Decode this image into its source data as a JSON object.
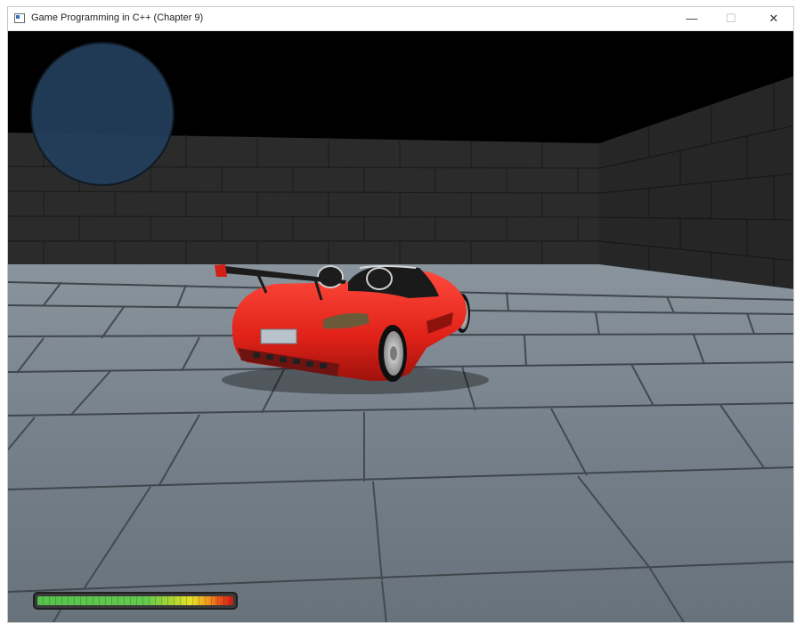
{
  "window": {
    "title": "Game Programming in C++ (Chapter 9)",
    "controls": {
      "minimize": "—",
      "maximize": "☐",
      "close": "✕"
    }
  },
  "hud": {
    "radar": {
      "color": "#233e5c"
    },
    "health_bar": {
      "level": 1.0,
      "gradient": [
        "#55c24a",
        "#e6e02a",
        "#c91e16"
      ]
    }
  },
  "scene": {
    "wall_color": "#2b2b2b",
    "floor_color": "#7c8791",
    "car_color": "#e8271f"
  }
}
